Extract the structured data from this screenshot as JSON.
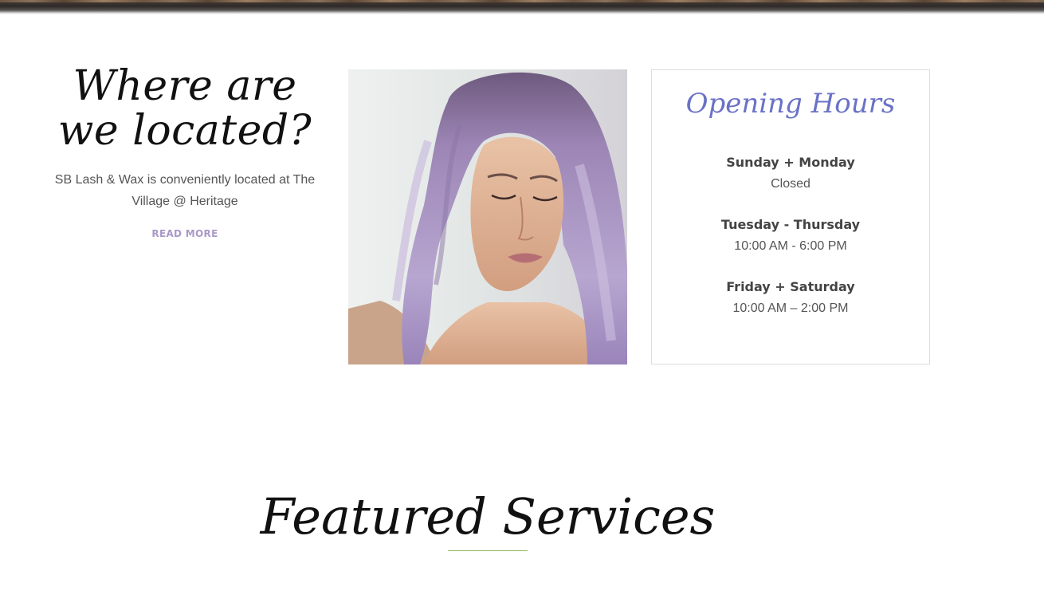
{
  "location": {
    "title": "Where are we located?",
    "text": "SB Lash & Wax is conveniently located at The Village @ Heritage",
    "link_label": "READ MORE"
  },
  "photo": {
    "alt": "woman-with-lavender-hair"
  },
  "hours": {
    "title": "Opening Hours",
    "groups": [
      {
        "day": "Sunday + Monday",
        "time": "Closed"
      },
      {
        "day": "Tuesday - Thursday",
        "time": "10:00 AM - 6:00 PM"
      },
      {
        "day": "Friday + Saturday",
        "time": "10:00 AM – 2:00 PM"
      }
    ]
  },
  "featured": {
    "title": "Featured Services"
  },
  "colors": {
    "accent_purple": "#a999c8",
    "hours_title_blue": "#6a72c6",
    "rule_green": "#8cba5a"
  }
}
